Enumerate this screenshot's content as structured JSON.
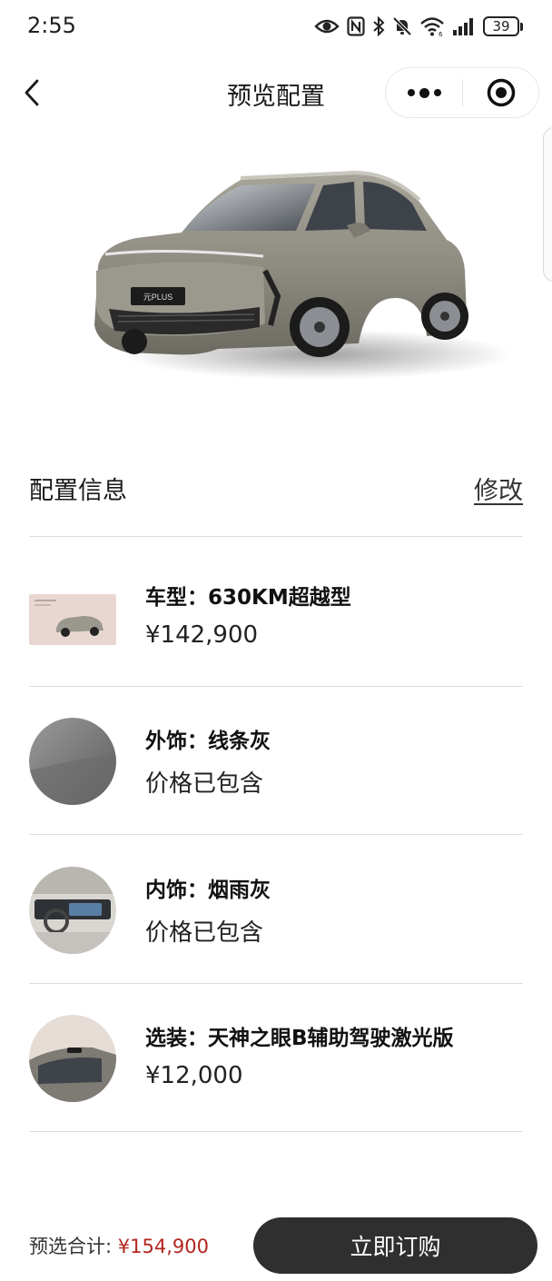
{
  "status_bar": {
    "time": "2:55",
    "battery": "39",
    "icons": [
      "eye-icon",
      "nfc-icon",
      "bluetooth-icon",
      "mute-icon",
      "wifi-icon",
      "signal-icon",
      "battery-icon"
    ]
  },
  "nav": {
    "title": "预览配置",
    "back_icon": "chevron-left-icon",
    "more_icon": "more-dots-icon",
    "close_icon": "target-close-icon"
  },
  "hero": {
    "badge": "元PLUS",
    "color": "#8f8c82"
  },
  "config": {
    "title": "配置信息",
    "edit_label": "修改",
    "items": [
      {
        "title": "车型：630KM超越型",
        "price": "¥142,900",
        "thumb": "car-model-thumbnail"
      },
      {
        "title": "外饰：线条灰",
        "price": "价格已包含",
        "thumb": "exterior-color-swatch"
      },
      {
        "title": "内饰：烟雨灰",
        "price": "价格已包含",
        "thumb": "interior-thumbnail"
      },
      {
        "title": "选装：天神之眼B辅助驾驶激光版",
        "price": "¥12,000",
        "thumb": "option-lidar-thumbnail"
      }
    ]
  },
  "footer": {
    "total_label": "预选合计:",
    "total_value": "¥154,900",
    "buy_label": "立即订购"
  },
  "colors": {
    "accent_price": "#b3261e",
    "button_bg": "#2f2f2f"
  }
}
